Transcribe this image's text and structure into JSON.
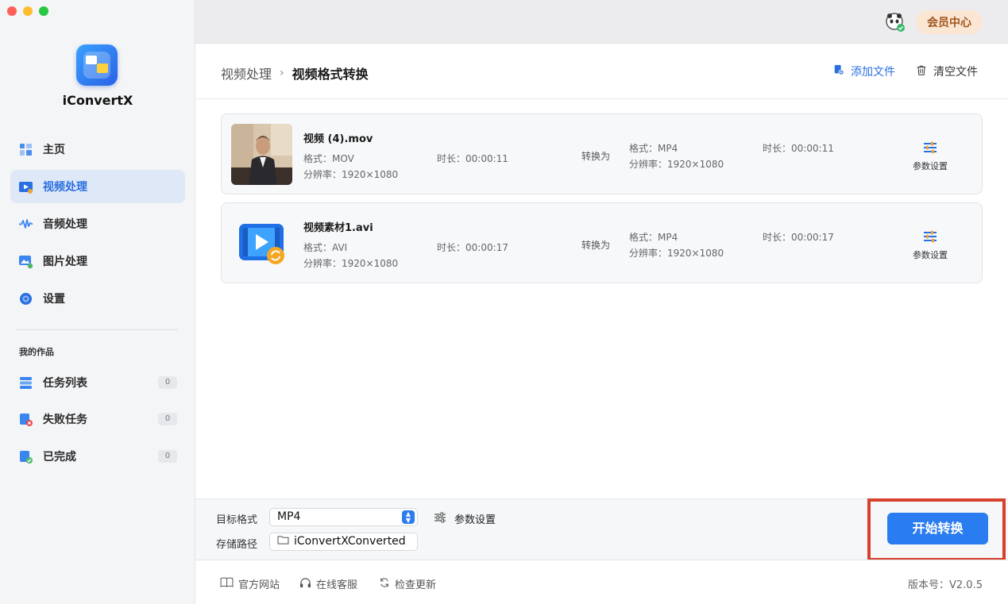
{
  "app": {
    "name": "iConvertX"
  },
  "sidebar": {
    "items": [
      {
        "label": "主页",
        "icon": "home-icon"
      },
      {
        "label": "视频处理",
        "icon": "video-icon",
        "active": true
      },
      {
        "label": "音频处理",
        "icon": "audio-wave-icon"
      },
      {
        "label": "图片处理",
        "icon": "image-icon"
      },
      {
        "label": "设置",
        "icon": "gear-icon"
      }
    ],
    "section_label": "我的作品",
    "works": [
      {
        "label": "任务列表",
        "count": "0",
        "icon": "task-list-icon"
      },
      {
        "label": "失败任务",
        "count": "0",
        "icon": "failed-task-icon"
      },
      {
        "label": "已完成",
        "count": "0",
        "icon": "completed-icon"
      }
    ]
  },
  "topbar": {
    "vip_label": "会员中心"
  },
  "header": {
    "breadcrumb_parent": "视频处理",
    "breadcrumb_sep": "›",
    "breadcrumb_current": "视频格式转换",
    "add_file": "添加文件",
    "clear_file": "清空文件"
  },
  "files": [
    {
      "name": "视频 (4).mov",
      "format": "格式：MOV",
      "resolution": "分辨率：1920×1080",
      "duration": "时长：00:00:11",
      "convert_to": "转换为",
      "target_format": "格式：MP4",
      "target_resolution": "分辨率：1920×1080",
      "target_duration": "时长：00:00:11",
      "param_label": "参数设置"
    },
    {
      "name": "视频素材1.avi",
      "format": "格式：AVI",
      "resolution": "分辨率：1920×1080",
      "duration": "时长：00:00:17",
      "convert_to": "转换为",
      "target_format": "格式：MP4",
      "target_resolution": "分辨率：1920×1080",
      "target_duration": "时长：00:00:17",
      "param_label": "参数设置"
    }
  ],
  "bottom": {
    "target_format_label": "目标格式",
    "target_format_value": "MP4",
    "param_label": "参数设置",
    "save_path_label": "存储路径",
    "save_path_value": "iConvertXConverted",
    "start_label": "开始转换"
  },
  "footer": {
    "website": "官方网站",
    "support": "在线客服",
    "update": "检查更新",
    "version": "版本号：V2.0.5"
  },
  "colors": {
    "accent": "#2a7df0",
    "highlight_box": "#d6402c",
    "vip_bg": "#fbe6d4"
  }
}
